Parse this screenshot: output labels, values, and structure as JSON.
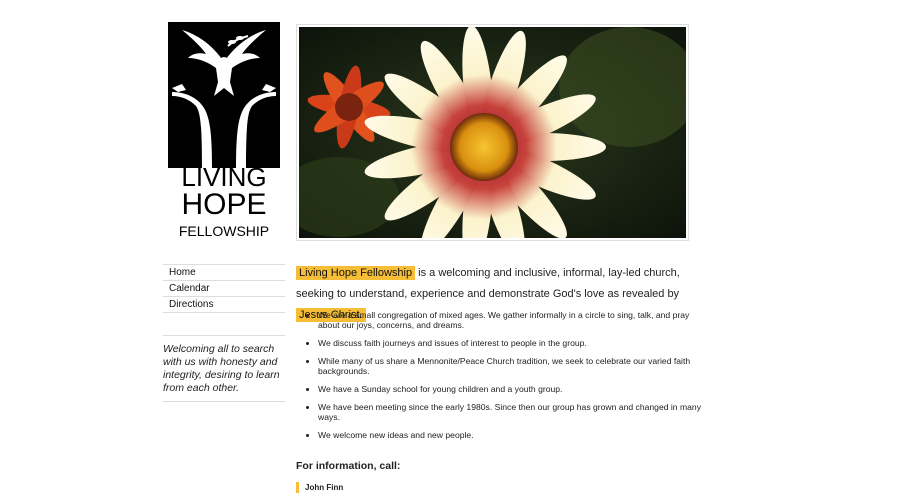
{
  "logo": {
    "line1": "LIVING",
    "line2": "HOPE",
    "line3": "FELLOWSHIP"
  },
  "nav": {
    "items": [
      "Home",
      "Calendar",
      "Directions"
    ]
  },
  "tagline": "Welcoming all to search with us with honesty and integrity, desiring to learn from each other.",
  "intro": {
    "org_name": "Living Hope Fellowship",
    "text_mid": " is a welcoming and inclusive, informal, lay-led church, seeking to understand, experience and demonstrate God's love as revealed by ",
    "highlight_end": "Jesus Christ."
  },
  "bullets": [
    "We are a small congregation of mixed ages. We gather informally in a circle to sing, talk, and pray about our joys, concerns, and dreams.",
    "We discuss faith journeys and issues of interest to people in the group.",
    "While many of us share a Mennonite/Peace Church tradition, we seek to celebrate our varied faith backgrounds.",
    "We have a Sunday school for young children and a youth group.",
    "We have been meeting since the early 1980s. Since then our group has grown and changed in many ways.",
    "We welcome new ideas and new people."
  ],
  "info": {
    "heading": "For information, call:",
    "contact_name": "John Finn"
  },
  "colors": {
    "highlight": "#f6be37",
    "divider": "#dddddd"
  }
}
